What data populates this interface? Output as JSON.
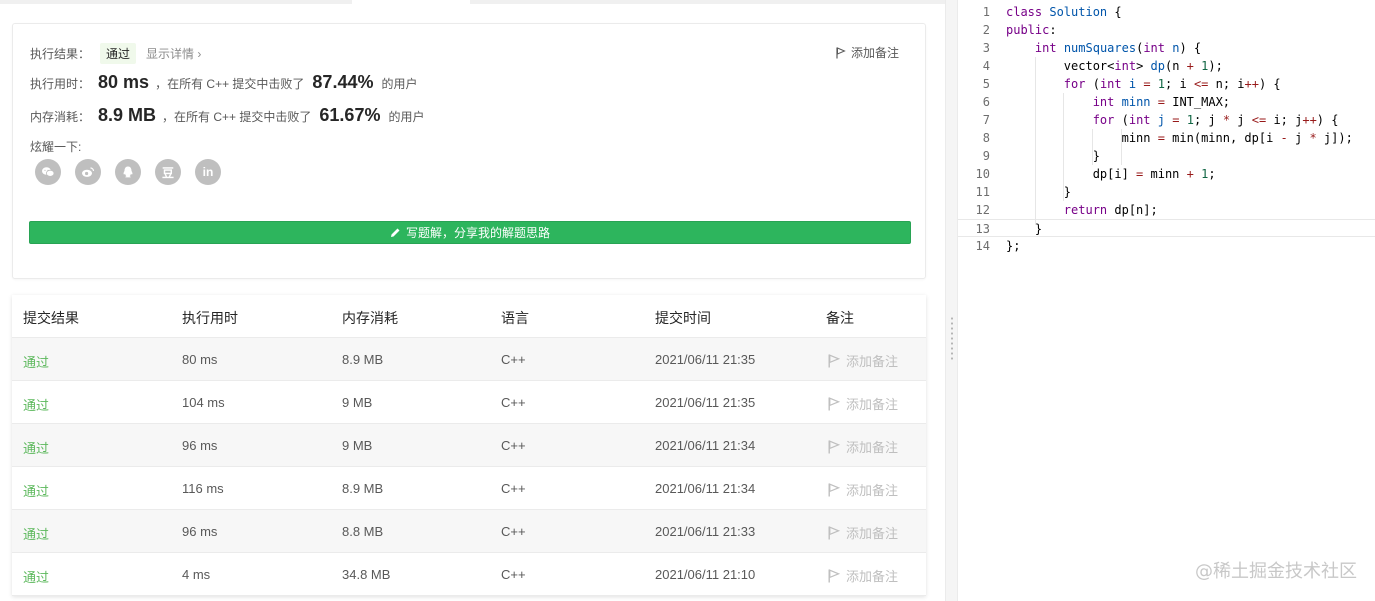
{
  "result": {
    "label": "执行结果：",
    "status": "通过",
    "detail_link": "显示详情 ›",
    "add_note": "添加备注"
  },
  "runtime": {
    "label": "执行用时：",
    "value": "80 ms",
    "prefix": "，在所有 C++ 提交中击败了",
    "percent": "87.44%",
    "suffix": "的用户"
  },
  "memory": {
    "label": "内存消耗：",
    "value": "8.9 MB",
    "prefix": "，在所有 C++ 提交中击败了",
    "percent": "61.67%",
    "suffix": "的用户"
  },
  "share": {
    "label": "炫耀一下:",
    "icons": [
      "wechat-icon",
      "weibo-icon",
      "qq-icon",
      "douban-icon",
      "linkedin-icon"
    ],
    "douban_text": "豆",
    "linkedin_text": "in"
  },
  "write_button": "写题解，分享我的解题思路",
  "table": {
    "headers": [
      "提交结果",
      "执行用时",
      "内存消耗",
      "语言",
      "提交时间",
      "备注"
    ],
    "rows": [
      {
        "status": "通过",
        "time": "80 ms",
        "memory": "8.9 MB",
        "lang": "C++",
        "submitted": "2021/06/11 21:35",
        "note": "添加备注"
      },
      {
        "status": "通过",
        "time": "104 ms",
        "memory": "9 MB",
        "lang": "C++",
        "submitted": "2021/06/11 21:35",
        "note": "添加备注"
      },
      {
        "status": "通过",
        "time": "96 ms",
        "memory": "9 MB",
        "lang": "C++",
        "submitted": "2021/06/11 21:34",
        "note": "添加备注"
      },
      {
        "status": "通过",
        "time": "116 ms",
        "memory": "8.9 MB",
        "lang": "C++",
        "submitted": "2021/06/11 21:34",
        "note": "添加备注"
      },
      {
        "status": "通过",
        "time": "96 ms",
        "memory": "8.8 MB",
        "lang": "C++",
        "submitted": "2021/06/11 21:33",
        "note": "添加备注"
      },
      {
        "status": "通过",
        "time": "4 ms",
        "memory": "34.8 MB",
        "lang": "C++",
        "submitted": "2021/06/11 21:10",
        "note": "添加备注"
      }
    ]
  },
  "editor": {
    "line_numbers": [
      "1",
      "2",
      "3",
      "4",
      "5",
      "6",
      "7",
      "8",
      "9",
      "10",
      "11",
      "12",
      "13",
      "14"
    ],
    "active_line": 13
  },
  "watermark": "@稀土掘金技术社区",
  "colors": {
    "accent_green": "#2db55d",
    "status_green": "#5cb85c",
    "keyword": "#770088",
    "number": "#116644"
  }
}
